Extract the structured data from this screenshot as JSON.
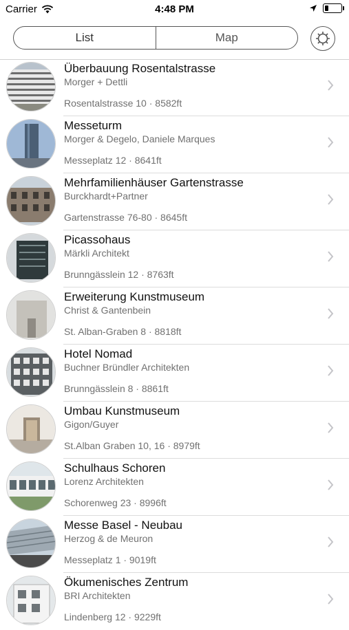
{
  "status": {
    "carrier": "Carrier",
    "time": "4:48 PM"
  },
  "nav": {
    "tabs": [
      {
        "label": "List"
      },
      {
        "label": "Map"
      }
    ],
    "settings_icon": "gear-icon"
  },
  "items": [
    {
      "title": "Überbauung Rosentalstrasse",
      "architect": "Morger + Dettli",
      "address": "Rosentalstrasse 10 · 8582ft"
    },
    {
      "title": "Messeturm",
      "architect": "Morger & Degelo, Daniele Marques",
      "address": "Messeplatz 12 · 8641ft"
    },
    {
      "title": "Mehrfamilienhäuser Gartenstrasse",
      "architect": "Burckhardt+Partner",
      "address": "Gartenstrasse 76-80 · 8645ft"
    },
    {
      "title": "Picassohaus",
      "architect": "Märkli Architekt",
      "address": "Brunngässlein 12 · 8763ft"
    },
    {
      "title": "Erweiterung Kunstmuseum",
      "architect": "Christ & Gantenbein",
      "address": "St. Alban-Graben 8 · 8818ft"
    },
    {
      "title": "Hotel Nomad",
      "architect": "Buchner Bründler Architekten",
      "address": "Brunngässlein 8 · 8861ft"
    },
    {
      "title": "Umbau Kunstmuseum",
      "architect": "Gigon/Guyer",
      "address": "St.Alban Graben 10, 16 · 8979ft"
    },
    {
      "title": "Schulhaus Schoren",
      "architect": "Lorenz Architekten",
      "address": "Schorenweg 23 · 8996ft"
    },
    {
      "title": "Messe Basel - Neubau",
      "architect": "Herzog & de Meuron",
      "address": "Messeplatz 1 · 9019ft"
    },
    {
      "title": "Ökumenisches Zentrum",
      "architect": "BRI Architekten",
      "address": "Lindenberg 12 · 9229ft"
    }
  ]
}
